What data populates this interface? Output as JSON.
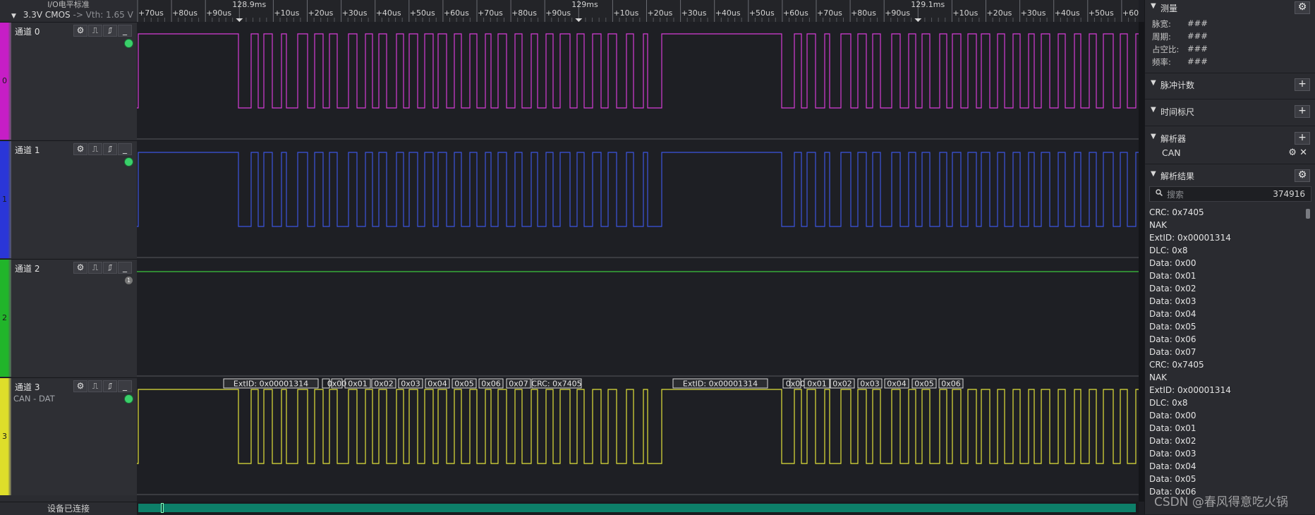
{
  "io_panel": {
    "title": "I/O电平标准",
    "level": "3.3V CMOS",
    "vth": "-> Vth: 1.65 V"
  },
  "ruler": {
    "labels": [
      "+70us",
      "+80us",
      "+90us",
      "128.9ms",
      "+10us",
      "+20us",
      "+30us",
      "+40us",
      "+50us",
      "+60us",
      "+70us",
      "+80us",
      "+90us",
      "129ms",
      "+10us",
      "+20us",
      "+30us",
      "+40us",
      "+50us",
      "+60us",
      "+70us",
      "+80us",
      "+90us",
      "129.1ms",
      "+10us",
      "+20us",
      "+30us",
      "+40us",
      "+50us",
      "+60us"
    ]
  },
  "channels": [
    {
      "index": "0",
      "name": "通道 0",
      "sub": "",
      "color": "#d63cd6",
      "strip": "#c61ec6",
      "led": "on"
    },
    {
      "index": "1",
      "name": "通道 1",
      "sub": "",
      "color": "#3c55e0",
      "strip": "#2a36d8",
      "led": "on"
    },
    {
      "index": "2",
      "name": "通道 2",
      "sub": "",
      "color": "#3cc83c",
      "strip": "#21b52a",
      "led": "1"
    },
    {
      "index": "3",
      "name": "通道 3",
      "sub": "CAN - DAT",
      "color": "#e2e23a",
      "strip": "#dede2a",
      "led": "on"
    }
  ],
  "channel_tool_icons": [
    "gear-icon",
    "rising-edge-icon",
    "high-level-icon",
    "falling-edge-icon",
    "low-level-icon"
  ],
  "decode_labels": [
    "ExtID: 0x00001314",
    "0x00",
    "0x01",
    "0x02",
    "0x03",
    "0x04",
    "0x05",
    "0x06",
    "0x07",
    "CRC: 0x7405",
    "ExtID: 0x00001314",
    "0x00",
    "0x01",
    "0x02",
    "0x03",
    "0x04",
    "0x05",
    "0x06"
  ],
  "status": "设备已连接",
  "right_panel": {
    "measure": {
      "title": "测量",
      "rows": [
        {
          "label": "脉宽:",
          "value": "###"
        },
        {
          "label": "周期:",
          "value": "###"
        },
        {
          "label": "占空比:",
          "value": "###"
        },
        {
          "label": "频率:",
          "value": "###"
        }
      ]
    },
    "pulse_count": {
      "title": "脉冲计数"
    },
    "time_ruler": {
      "title": "时间标尺"
    },
    "decoder": {
      "title": "解析器",
      "item": "CAN"
    },
    "results": {
      "title": "解析结果",
      "search_placeholder": "搜索",
      "count": "374916",
      "items": [
        "CRC: 0x7405",
        "NAK",
        "ExtID: 0x00001314",
        "DLC: 0x8",
        "Data: 0x00",
        "Data: 0x01",
        "Data: 0x02",
        "Data: 0x03",
        "Data: 0x04",
        "Data: 0x05",
        "Data: 0x06",
        "Data: 0x07",
        "CRC: 0x7405",
        "NAK",
        "ExtID: 0x00001314",
        "DLC: 0x8",
        "Data: 0x00",
        "Data: 0x01",
        "Data: 0x02",
        "Data: 0x03",
        "Data: 0x04",
        "Data: 0x05",
        "Data: 0x06"
      ]
    }
  },
  "watermark": "CSDN @春风得意吃火锅"
}
